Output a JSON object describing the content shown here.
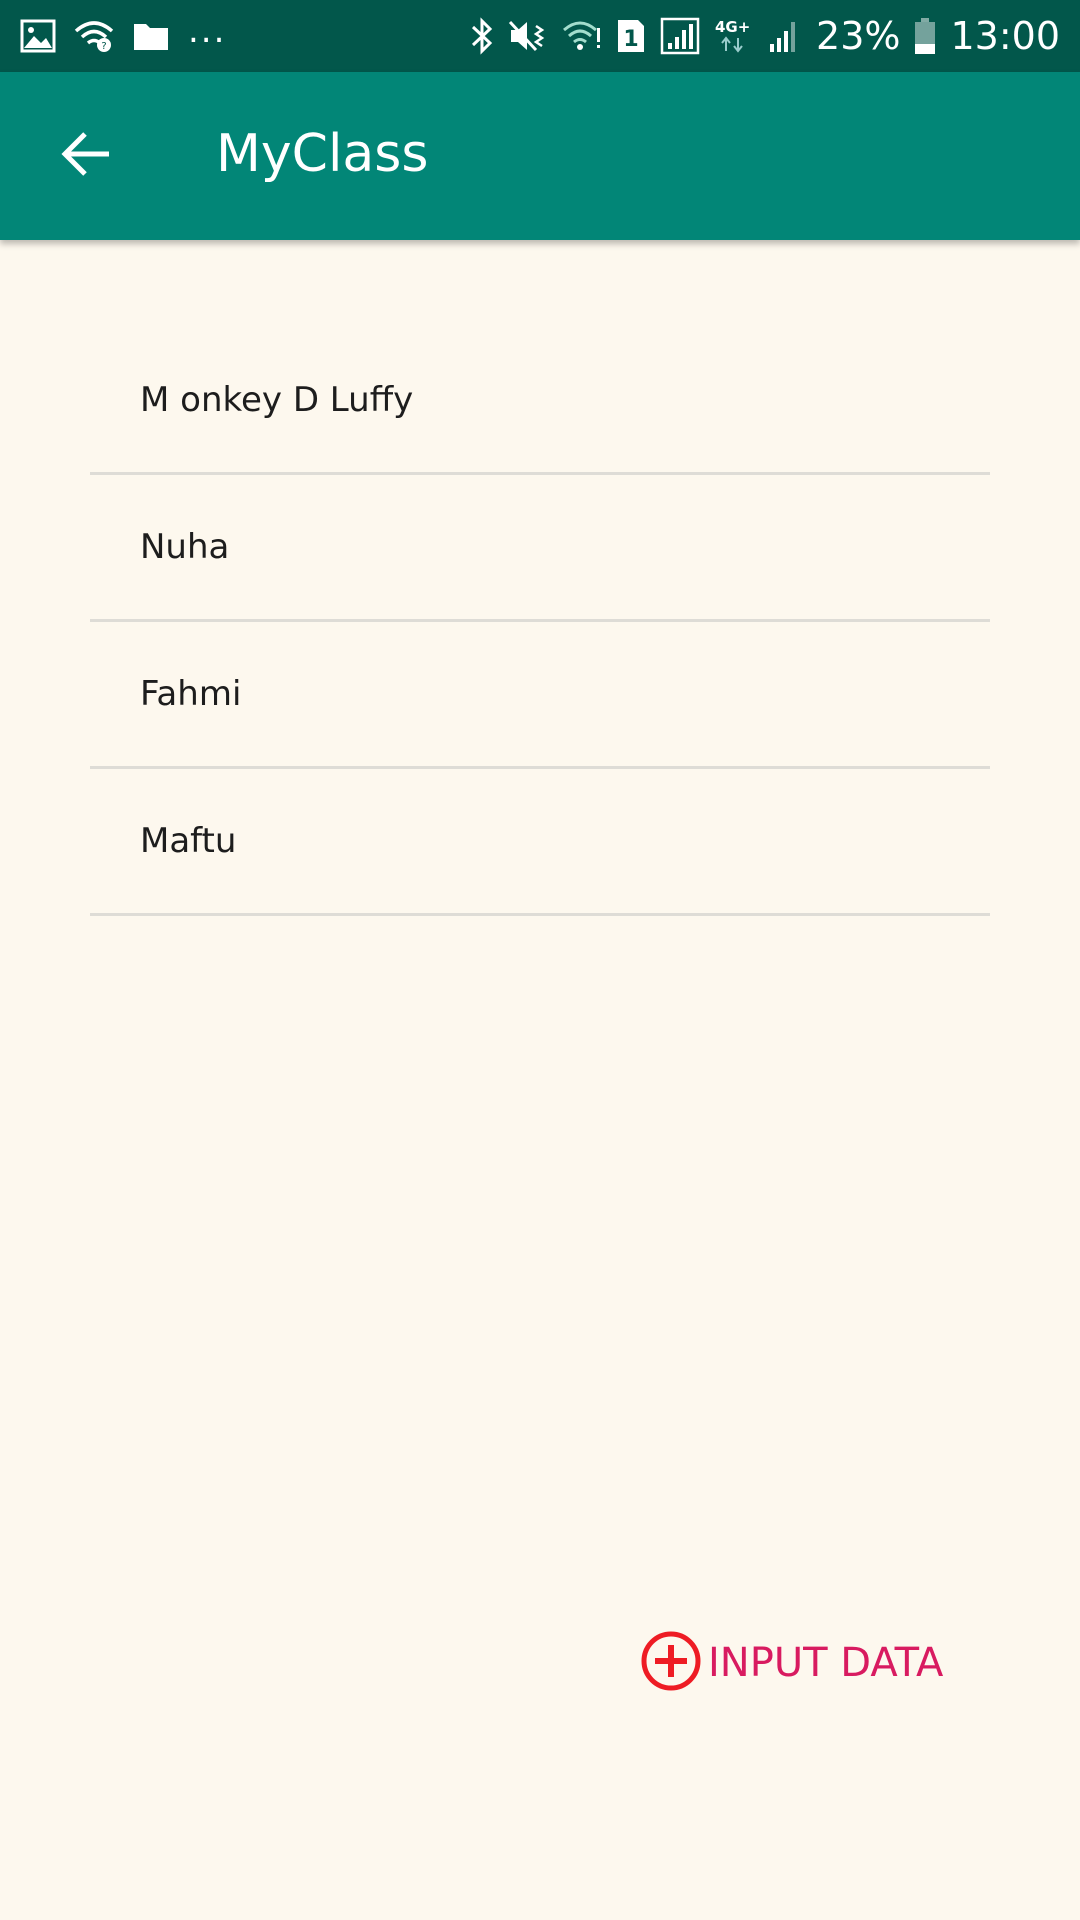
{
  "status_bar": {
    "left_icons": [
      "image-icon",
      "wifi-question-icon",
      "folder-icon"
    ],
    "more": "...",
    "right_icons": [
      "bluetooth-icon",
      "vibrate-icon",
      "wifi-icon",
      "sim-1-icon",
      "signal-icon",
      "4g-plus-icon",
      "signal-weak-icon",
      "battery-icon"
    ],
    "battery": "23%",
    "time": "13:00"
  },
  "app_bar": {
    "title": "MyClass",
    "back_icon": "arrow-left-icon"
  },
  "list": {
    "items": [
      {
        "label": "M onkey D Luffy"
      },
      {
        "label": "Nuha"
      },
      {
        "label": "Fahmi"
      },
      {
        "label": "Maftu"
      }
    ]
  },
  "action": {
    "label": "INPUT DATA",
    "icon": "add-circle-icon",
    "color": "#d81b60",
    "icon_color": "#ee1c24"
  },
  "colors": {
    "status_bar": "#02574b",
    "app_bar": "#028677",
    "background": "#fdf8ee"
  }
}
